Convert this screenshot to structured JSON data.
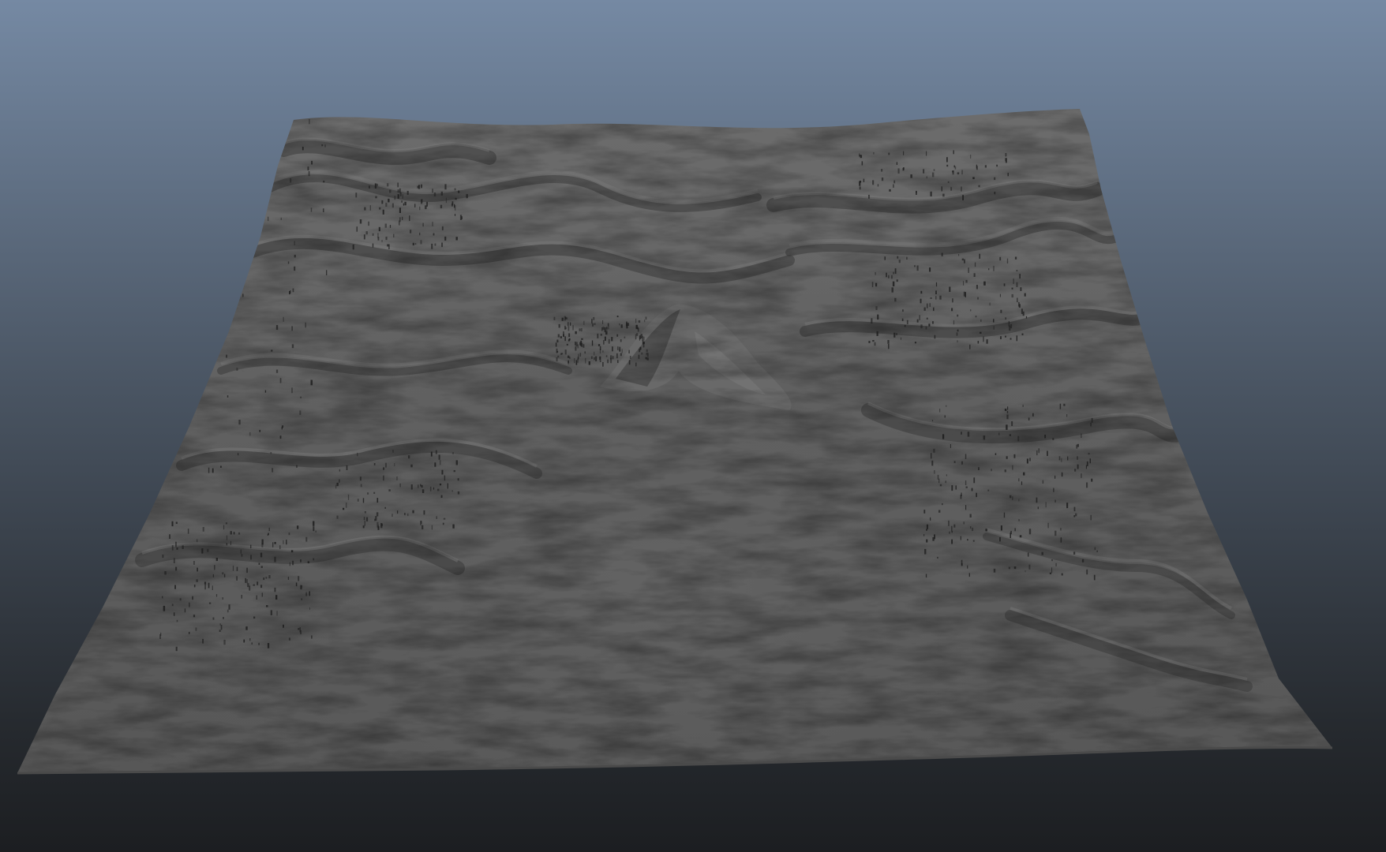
{
  "viewport": {
    "background_top_color": "#7589a3",
    "background_mid_color": "#4a5563",
    "background_bottom_color": "#1c1e21",
    "shading_mode": "smooth-shaded-gray"
  },
  "terrain": {
    "surface_color": "#5e5e5e",
    "ridge_shadow_color": "#3a3a3a",
    "highlight_color": "#7a7a7a",
    "peak_present": true,
    "vegetation_scatter_color": "#1e1e1e"
  }
}
